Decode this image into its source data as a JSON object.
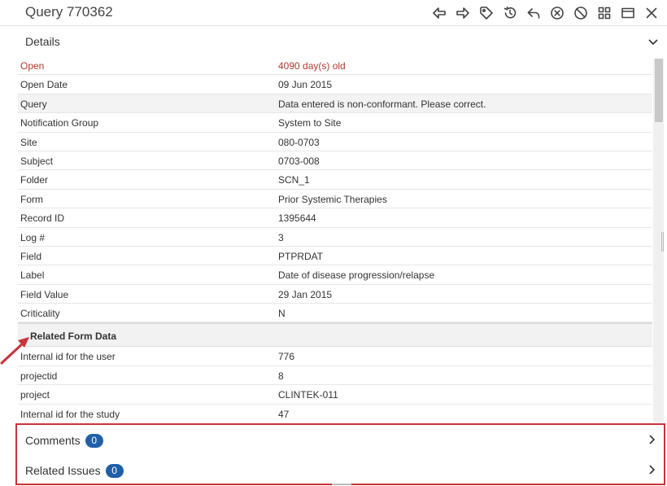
{
  "window": {
    "title": "Query 770362"
  },
  "toolbar": {
    "buttons": [
      {
        "name": "previous-button",
        "icon": "arrow-left-icon"
      },
      {
        "name": "next-button",
        "icon": "arrow-right-icon"
      },
      {
        "name": "tag-button",
        "icon": "tag-icon"
      },
      {
        "name": "history-button",
        "icon": "history-icon"
      },
      {
        "name": "reply-button",
        "icon": "reply-icon"
      },
      {
        "name": "cancel-query-button",
        "icon": "circle-x-icon"
      },
      {
        "name": "close-query-button",
        "icon": "prohibit-icon"
      },
      {
        "name": "layout-button",
        "icon": "dashboard-icon"
      },
      {
        "name": "maximize-button",
        "icon": "window-icon"
      },
      {
        "name": "close-button",
        "icon": "close-icon"
      }
    ]
  },
  "details": {
    "heading": "Details",
    "status": {
      "label": "Open",
      "value": "4090 day(s) old",
      "color": "#b03a2e"
    },
    "rows": [
      {
        "label": "Open Date",
        "value": "09 Jun 2015"
      },
      {
        "label": "Query",
        "value": "Data entered is non-conformant. Please correct."
      },
      {
        "label": "Notification Group",
        "value": "System to Site"
      },
      {
        "label": "Site",
        "value": "080-0703"
      },
      {
        "label": "Subject",
        "value": "0703-008"
      },
      {
        "label": "Folder",
        "value": "SCN_1"
      },
      {
        "label": "Form",
        "value": "Prior Systemic Therapies"
      },
      {
        "label": "Record ID",
        "value": "1395644"
      },
      {
        "label": "Log #",
        "value": "3"
      },
      {
        "label": "Field",
        "value": "PTPRDAT"
      },
      {
        "label": "Label",
        "value": "Date of disease progression/relapse"
      },
      {
        "label": "Field Value",
        "value": "29 Jan 2015"
      },
      {
        "label": "Criticality",
        "value": "N"
      }
    ],
    "related_form_data": {
      "heading": "Related Form Data",
      "rows": [
        {
          "label": "Internal id for the user",
          "value": "776"
        },
        {
          "label": "projectid",
          "value": "8"
        },
        {
          "label": "project",
          "value": "CLINTEK-011"
        },
        {
          "label": "Internal id for the study",
          "value": "47"
        }
      ]
    }
  },
  "bottom_panel": {
    "comments": {
      "label": "Comments",
      "count": "0"
    },
    "related_issues": {
      "label": "Related Issues",
      "count": "0"
    },
    "highlight_color": "#c8343a",
    "badge_color": "#1f5fa8"
  }
}
